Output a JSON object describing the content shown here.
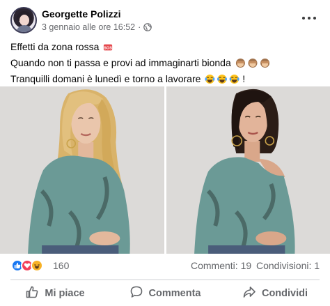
{
  "post": {
    "author": "Georgette Polizzi",
    "timestamp": "3 gennaio alle ore 16:52",
    "separator": "·",
    "audience_icon": "globe-icon",
    "menu_icon": "more-options-icon",
    "text_lines": [
      "Effetti da zona rossa",
      "Quando non ti passa e provi ad immaginarti bionda",
      "Tranquilli domani è lunedì e torno a lavorare"
    ],
    "line3_suffix": "!",
    "emojis": [
      "sos-emoji",
      "see-no-evil-monkey-emoji",
      "crying-laughing-emoji"
    ]
  },
  "photos": [
    {
      "name": "photo-blonde",
      "hair_color": "#d9b36a"
    },
    {
      "name": "photo-brunette",
      "hair_color": "#2b1d17"
    }
  ],
  "stats": {
    "reaction_icons": [
      "like-reaction-icon",
      "love-reaction-icon",
      "haha-reaction-icon"
    ],
    "reaction_count": "160",
    "comments": "Commenti: 19",
    "shares": "Condivisioni: 1"
  },
  "actions": {
    "like": "Mi piace",
    "comment": "Commenta",
    "share": "Condividi"
  },
  "colors": {
    "like_blue": "#1877f2",
    "love_red": "#f33e58",
    "haha_yellow": "#f7b125",
    "secondary_text": "#65676b"
  }
}
